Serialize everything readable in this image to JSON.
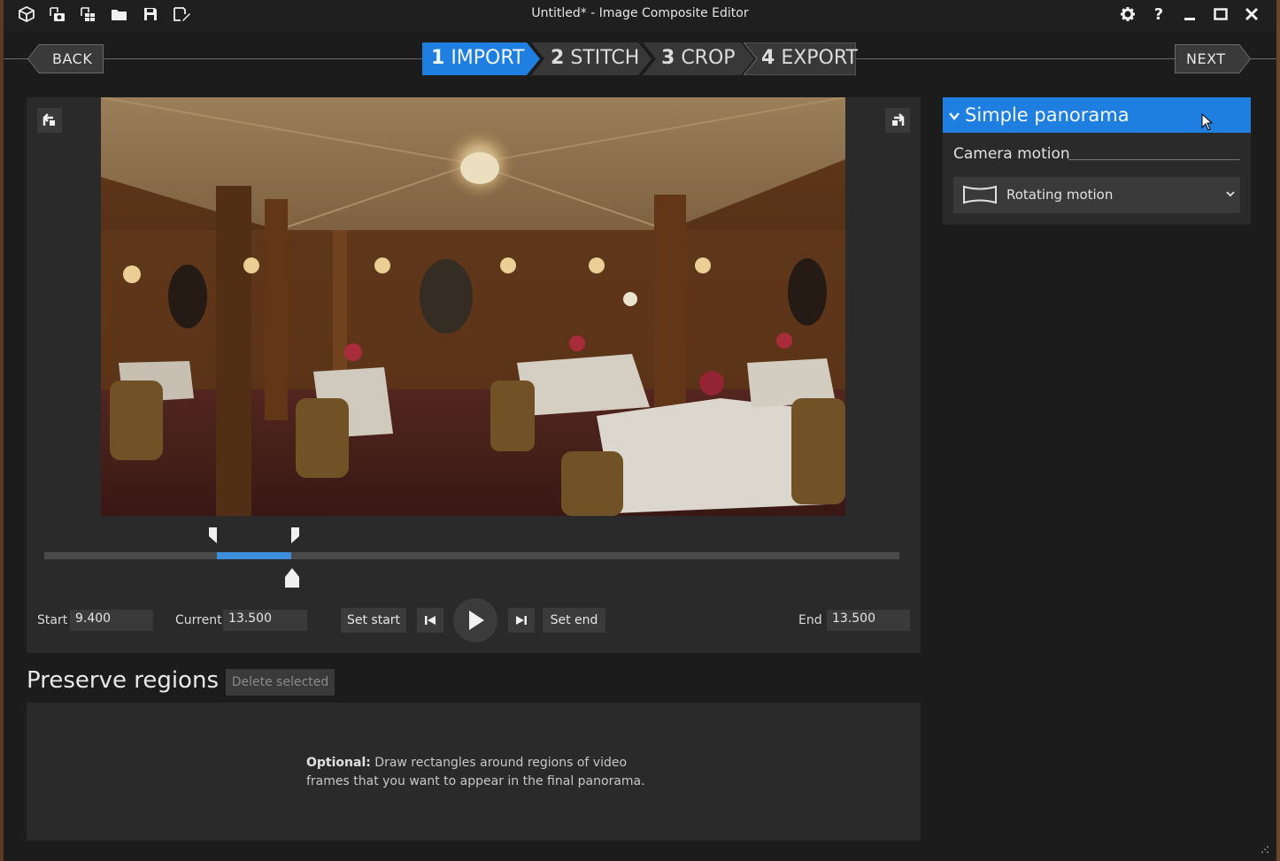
{
  "window": {
    "title": "Untitled* - Image Composite Editor"
  },
  "toolbar": {
    "icons": [
      "new-panorama-icon",
      "new-from-video-icon",
      "new-from-images-icon",
      "open-icon",
      "save-icon",
      "save-as-icon"
    ]
  },
  "window_controls": [
    "settings-icon",
    "help-icon",
    "minimize-icon",
    "maximize-icon",
    "close-icon"
  ],
  "workflow": {
    "back_label": "BACK",
    "next_label": "NEXT",
    "steps": [
      {
        "num": "1",
        "label": "IMPORT",
        "active": true
      },
      {
        "num": "2",
        "label": "STITCH",
        "active": false
      },
      {
        "num": "3",
        "label": "CROP",
        "active": false
      },
      {
        "num": "4",
        "label": "EXPORT",
        "active": false
      }
    ]
  },
  "timeline": {
    "start_label": "Start",
    "start_value": "9.400",
    "current_label": "Current",
    "current_value": "13.500",
    "end_label": "End",
    "end_value": "13.500",
    "set_start_label": "Set start",
    "set_end_label": "Set end"
  },
  "preserve": {
    "title": "Preserve regions",
    "delete_label": "Delete selected",
    "hint_bold": "Optional:",
    "hint_line1": " Draw rectangles around regions of video",
    "hint_line2": "frames that you want to appear in the final panorama."
  },
  "right_panel": {
    "header": "Simple panorama",
    "camera_motion_label": "Camera motion",
    "camera_motion_value": "Rotating motion"
  },
  "colors": {
    "accent": "#1f7fe0",
    "selection": "#3d8fdc"
  }
}
